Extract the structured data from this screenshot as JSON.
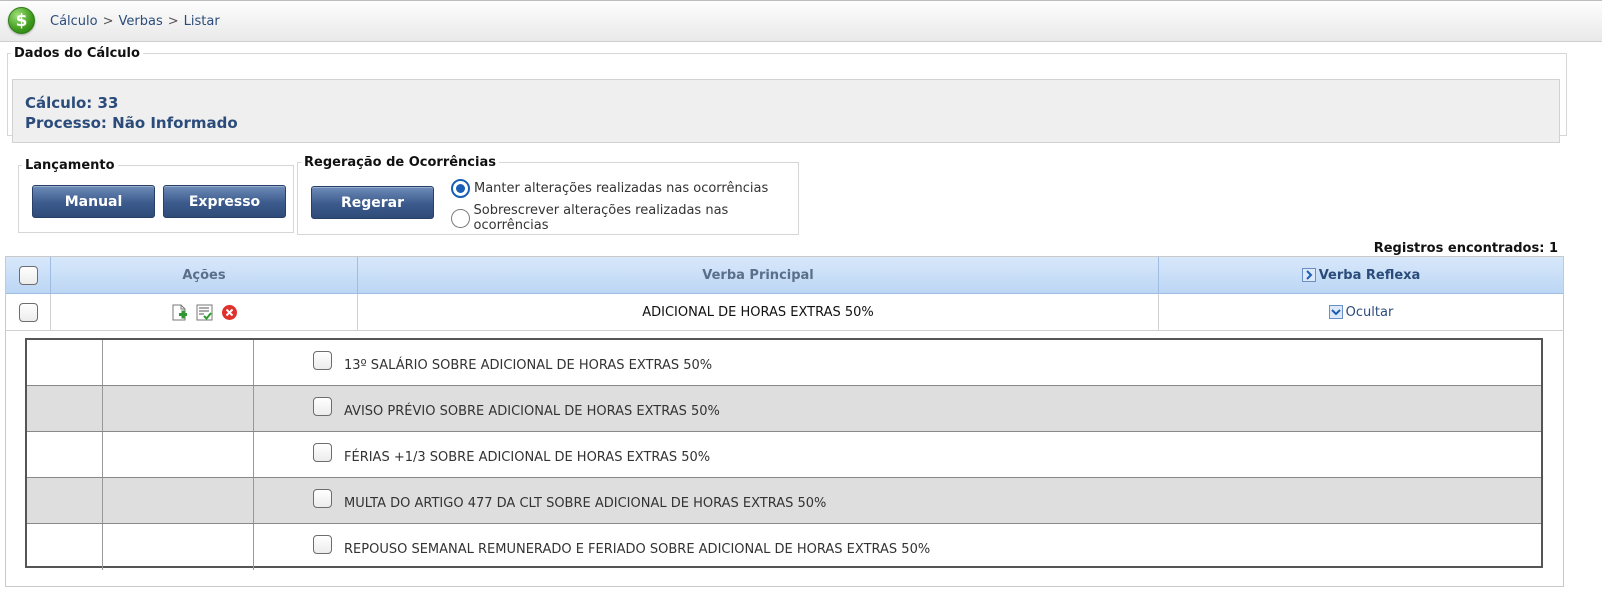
{
  "breadcrumb": [
    "Cálculo",
    "Verbas",
    "Listar"
  ],
  "breadcrumb_sep": ">",
  "logo_symbol": "$",
  "dados": {
    "legend": "Dados do Cálculo",
    "calculo": "Cálculo: 33",
    "processo": "Processo: Não Informado"
  },
  "lancamento": {
    "legend": "Lançamento",
    "manual": "Manual",
    "expresso": "Expresso"
  },
  "regeracao": {
    "legend": "Regeração de Ocorrências",
    "regerar": "Regerar",
    "options": [
      {
        "label": "Manter alterações realizadas nas ocorrências",
        "selected": true
      },
      {
        "label": "Sobrescrever alterações realizadas nas ocorrências",
        "selected": false
      }
    ]
  },
  "registros": "Registros encontrados: 1",
  "table": {
    "headers": {
      "acoes": "Ações",
      "verba_principal": "Verba Principal",
      "verba_reflexa": "Verba Reflexa"
    },
    "row": {
      "verba_principal": "ADICIONAL DE HORAS EXTRAS 50%",
      "reflexa_link": "Ocultar",
      "icons": [
        "new-document-icon",
        "checklist-icon",
        "delete-icon"
      ]
    },
    "reflexas": [
      "13º SALÁRIO SOBRE ADICIONAL DE HORAS EXTRAS 50%",
      "AVISO PRÉVIO SOBRE ADICIONAL DE HORAS EXTRAS 50%",
      "FÉRIAS +1/3 SOBRE ADICIONAL DE HORAS EXTRAS 50%",
      "MULTA DO ARTIGO 477 DA CLT SOBRE ADICIONAL DE HORAS EXTRAS 50%",
      "REPOUSO SEMANAL REMUNERADO E FERIADO SOBRE ADICIONAL DE HORAS EXTRAS 50%"
    ]
  },
  "colors": {
    "accent": "#2b4c7a",
    "button": "#3b5a8c",
    "header_bg": "#bcd6f4"
  }
}
